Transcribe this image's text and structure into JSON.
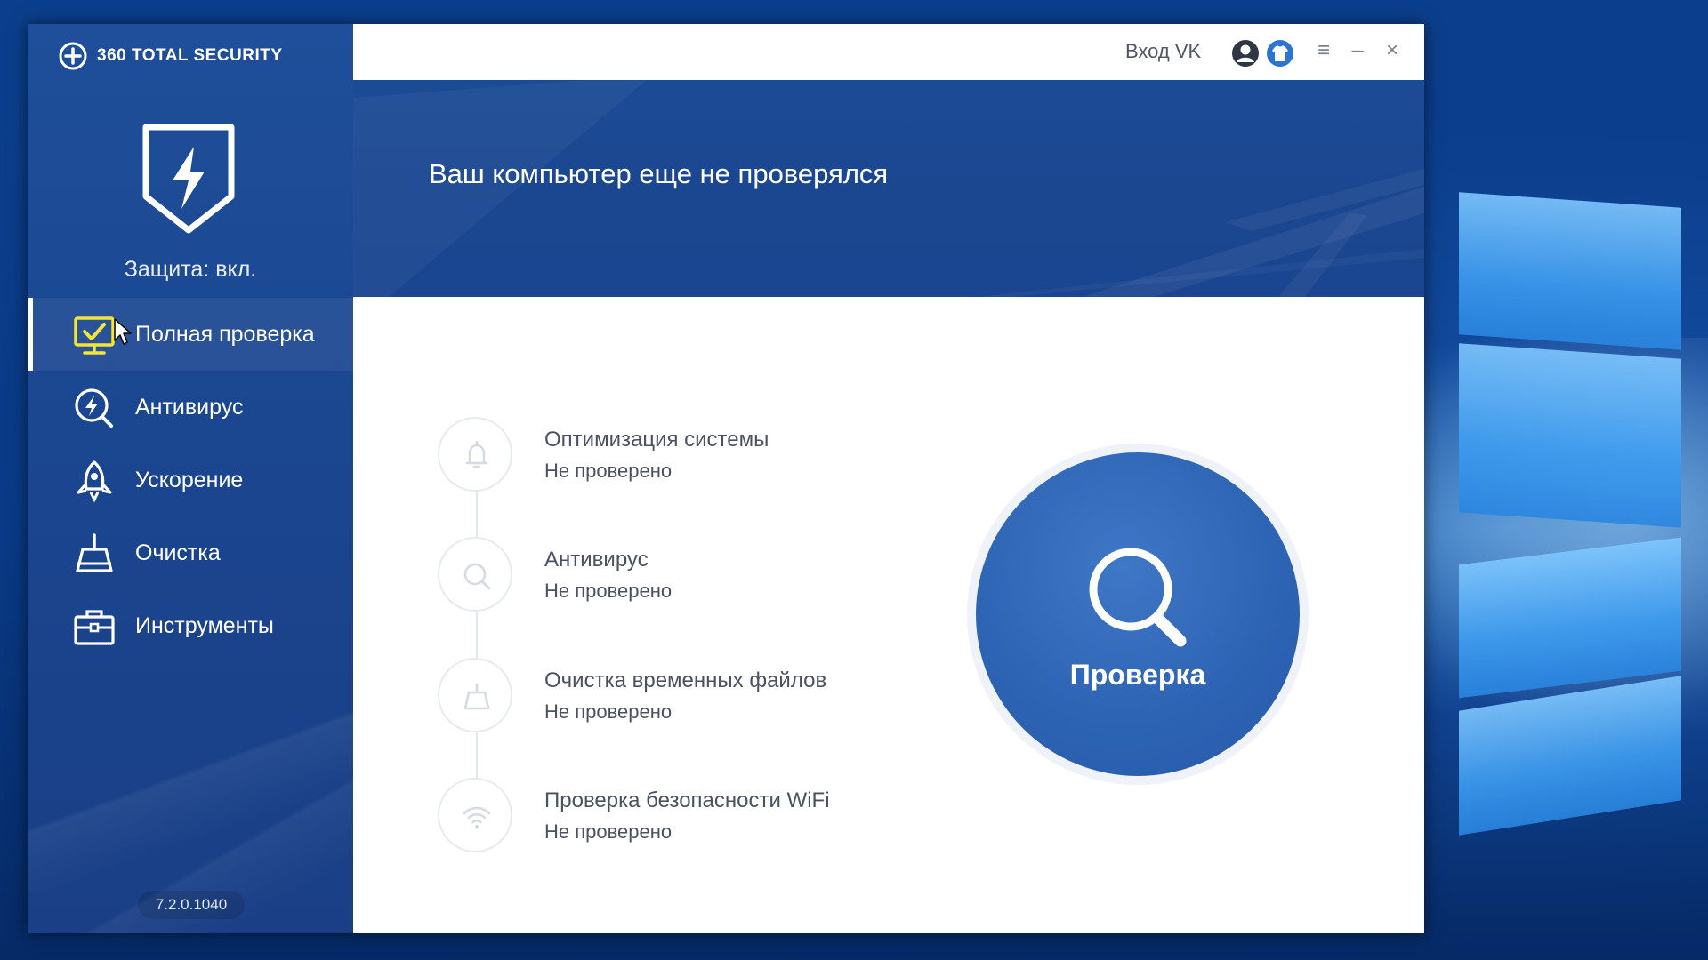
{
  "app": {
    "brand": "360 TOTAL SECURITY",
    "protection_status": "Защита: вкл.",
    "version": "7.2.0.1040"
  },
  "sidebar": {
    "items": [
      {
        "label": "Полная проверка",
        "icon": "monitor-check-icon",
        "active": true
      },
      {
        "label": "Антивирус",
        "icon": "antivirus-bolt-icon",
        "active": false
      },
      {
        "label": "Ускорение",
        "icon": "rocket-icon",
        "active": false
      },
      {
        "label": "Очистка",
        "icon": "broom-icon",
        "active": false
      },
      {
        "label": "Инструменты",
        "icon": "toolbox-icon",
        "active": false
      }
    ]
  },
  "titlebar": {
    "login_label": "Вход VK",
    "menu_glyph": "≡",
    "minimize_glyph": "–",
    "close_glyph": "×"
  },
  "banner": {
    "title": "Ваш компьютер еще не проверялся"
  },
  "checks": [
    {
      "title": "Оптимизация системы",
      "status": "Не проверено",
      "icon": "bell-icon"
    },
    {
      "title": "Антивирус",
      "status": "Не проверено",
      "icon": "search-icon"
    },
    {
      "title": "Очистка временных файлов",
      "status": "Не проверено",
      "icon": "cleanup-icon"
    },
    {
      "title": "Проверка безопасности WiFi",
      "status": "Не проверено",
      "icon": "wifi-icon"
    }
  ],
  "scan_button": {
    "label": "Проверка"
  },
  "colors": {
    "sidebar_blue": "#1b4690",
    "accent_yellow": "#f2e43a",
    "scan_blue": "#2e64b4"
  }
}
